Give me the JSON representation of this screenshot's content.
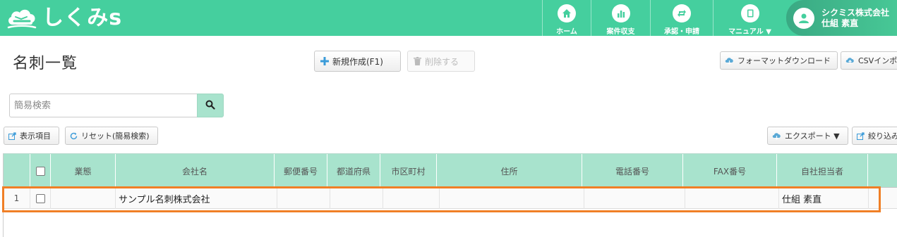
{
  "brand": {
    "logo_text": "しくみs"
  },
  "nav": {
    "items": [
      {
        "label": "ホーム",
        "icon": "home-icon"
      },
      {
        "label": "案件収支",
        "icon": "bar-chart-icon"
      },
      {
        "label": "承認・申請",
        "icon": "repeat-icon"
      },
      {
        "label": "マニュアル ▼",
        "icon": "book-icon"
      }
    ]
  },
  "user": {
    "company": "シクミス株式会社",
    "name": "仕組 素直",
    "icon": "user-icon"
  },
  "page": {
    "title": "名刺一覧"
  },
  "toolbar": {
    "new_label": "新規作成(F1)",
    "delete_label": "削除する",
    "format_download_label": "フォーマットダウンロード",
    "csv_import_label": "CSVインポ",
    "display_items_label": "表示項目",
    "reset_label": "リセット(簡易検索)",
    "export_label": "エクスポート ▼",
    "filter_label": "絞り込み"
  },
  "search": {
    "placeholder": "簡易検索"
  },
  "table": {
    "headers": [
      "業態",
      "会社名",
      "郵便番号",
      "都道府県",
      "市区町村",
      "住所",
      "電話番号",
      "FAX番号",
      "自社担当者"
    ],
    "rows": [
      {
        "index": "1",
        "gyotai": "",
        "company": "サンプル名刺株式会社",
        "postal": "",
        "prefecture": "",
        "city": "",
        "address": "",
        "phone": "",
        "fax": "",
        "owner": "仕組 素直"
      }
    ]
  },
  "colors": {
    "header_bg": "#45cf9e",
    "table_header_bg": "#a8e3cd",
    "highlight": "#f07f26"
  }
}
